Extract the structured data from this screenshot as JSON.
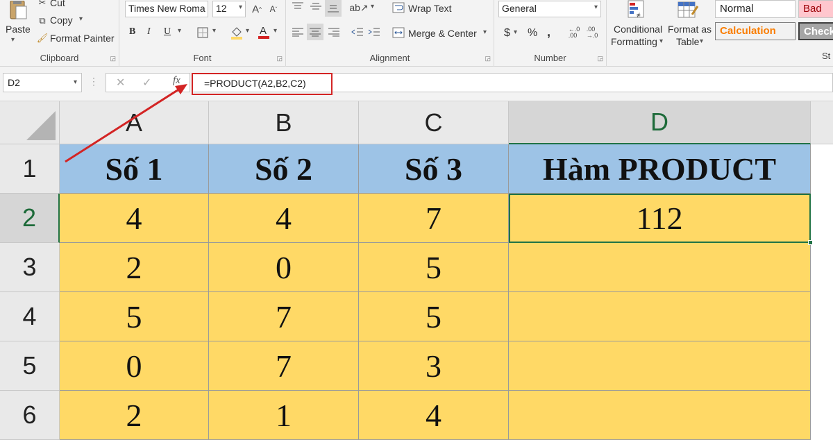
{
  "ribbon": {
    "clipboard": {
      "label": "Clipboard",
      "paste": "Paste",
      "cut": "Cut",
      "copy": "Copy",
      "format_painter": "Format Painter"
    },
    "font": {
      "label": "Font",
      "font_name": "Times New Roma",
      "font_size": "12",
      "bold": "B",
      "italic": "I",
      "underline": "U"
    },
    "alignment": {
      "label": "Alignment",
      "wrap_text": "Wrap Text",
      "merge_center": "Merge & Center"
    },
    "number": {
      "label": "Number",
      "format": "General",
      "currency": "$",
      "percent": "%",
      "comma": ","
    },
    "styles": {
      "conditional_formatting_1": "Conditional",
      "conditional_formatting_2": "Formatting",
      "format_as_table_1": "Format as",
      "format_as_table_2": "Table",
      "normal": "Normal",
      "bad": "Bad",
      "calculation": "Calculation",
      "check": "Check",
      "label_partial": "St"
    }
  },
  "formula_bar": {
    "name_box": "D2",
    "fx": "fx",
    "formula": "=PRODUCT(A2,B2,C2)"
  },
  "sheet": {
    "columns": [
      "A",
      "B",
      "C",
      "D"
    ],
    "rows": [
      "1",
      "2",
      "3",
      "4",
      "5",
      "6"
    ],
    "headers": [
      "Số 1",
      "Số 2",
      "Số 3",
      "Hàm PRODUCT"
    ],
    "data": [
      [
        "4",
        "4",
        "7",
        "112"
      ],
      [
        "2",
        "0",
        "5",
        ""
      ],
      [
        "5",
        "7",
        "5",
        ""
      ],
      [
        "0",
        "7",
        "3",
        ""
      ],
      [
        "2",
        "1",
        "4",
        ""
      ]
    ],
    "selected_cell": "D2"
  },
  "colors": {
    "header_fill": "#9dc3e6",
    "data_fill": "#ffd966",
    "selection": "#217346",
    "annotation": "#d32424"
  }
}
